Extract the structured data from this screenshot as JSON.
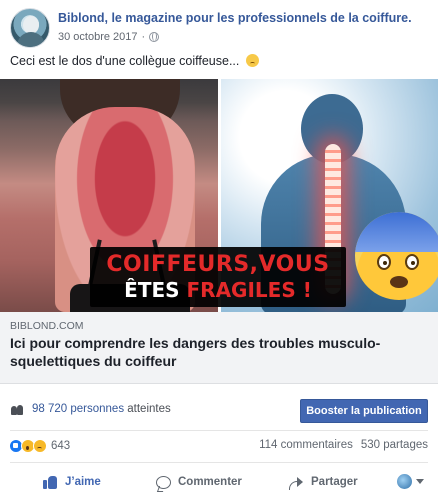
{
  "post": {
    "page_name": "Biblond, le magazine pour les professionnels de la coiffure.",
    "date": "30 octobre 2017",
    "privacy_icon": "globe-icon",
    "text": "Ceci est le dos d'une collègue coiffeuse...",
    "text_emoji": "worried-face-emoji"
  },
  "media": {
    "banner_line1": "COIFFEURS,VOUS",
    "banner_line2_white": "ÊTES ",
    "banner_line2_red": "FRAGILES !",
    "overlay_emoji": "scared-face-emoji"
  },
  "link": {
    "domain": "BIBLOND.COM",
    "title": "Ici pour comprendre les dangers des troubles musculo-squelettiques du coiffeur"
  },
  "reach": {
    "count": "98 720 personnes",
    "suffix": " atteintes",
    "boost_label": "Booster la publication"
  },
  "stats": {
    "reaction_icons": [
      "like",
      "wow",
      "sad"
    ],
    "reactions_count": "643",
    "comments": "114 commentaires",
    "shares": "530 partages"
  },
  "actions": {
    "like": "J’aime",
    "comment": "Commenter",
    "share": "Partager"
  },
  "colors": {
    "link_blue": "#365899",
    "button_blue": "#4267b2",
    "banner_red": "#e42a2a"
  }
}
